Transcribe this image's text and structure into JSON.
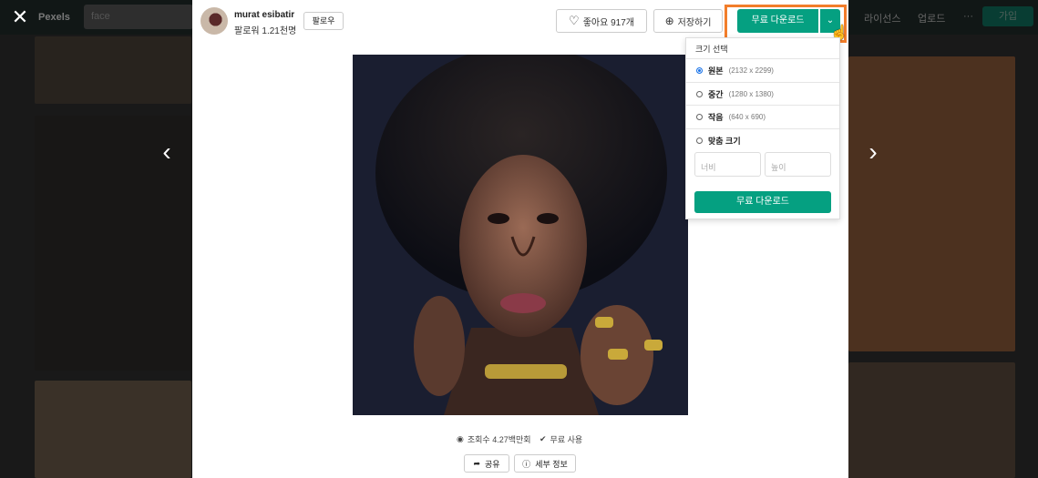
{
  "background": {
    "brand": "Pexels",
    "search_text": "face",
    "nav_items": [
      "라이선스",
      "업로드",
      "···"
    ],
    "join_label": "가입"
  },
  "modal": {
    "author": {
      "name": "murat esibatir",
      "followers": "팔로워 1.21천명"
    },
    "follow_label": "팔로우",
    "like_label": "좋아요 917개",
    "save_label": "저장하기",
    "download_label": "무료 다운로드",
    "dropdown": {
      "title": "크기 선택",
      "options": [
        {
          "label": "원본",
          "size": "(2132 x 2299)",
          "selected": true
        },
        {
          "label": "중간",
          "size": "(1280 x 1380)",
          "selected": false
        },
        {
          "label": "작음",
          "size": "(640 x 690)",
          "selected": false
        },
        {
          "label": "맞춤 크기",
          "size": "",
          "selected": false
        }
      ],
      "width_placeholder": "너비",
      "height_placeholder": "높이",
      "download_label": "무료 다운로드"
    },
    "stats": {
      "views": "조회수 4.27백만회",
      "license": "무료 사용"
    },
    "share_label": "공유",
    "info_label": "세부 정보"
  },
  "colors": {
    "accent": "#05a081",
    "highlight": "#f27d2a"
  }
}
